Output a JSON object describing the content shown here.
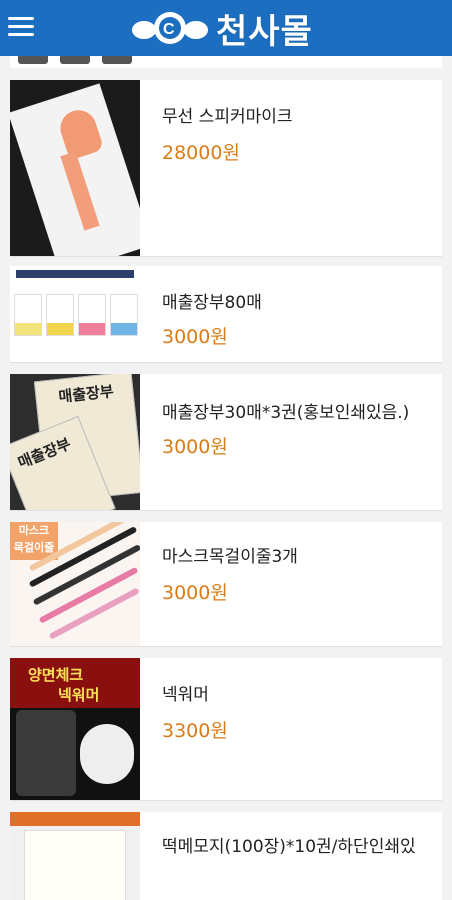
{
  "header": {
    "brand_text": "천사몰",
    "logo_icon": "angel-c-logo-icon",
    "menu_icon": "hamburger-menu-icon",
    "color": "#1c6fc0"
  },
  "products": [
    {
      "name": "무선 스피커마이크",
      "price": "28000원"
    },
    {
      "name": "매출장부80매",
      "price": "3000원"
    },
    {
      "name": "매출장부30매*3권(홍보인쇄있음.)",
      "price": "3000원"
    },
    {
      "name": "마스크목걸이줄3개",
      "price": "3000원"
    },
    {
      "name": "넥워머",
      "price": "3300원"
    },
    {
      "name": "떡메모지(100장)*10권/하단인쇄있",
      "price": ""
    }
  ],
  "thumbs": {
    "ledger_cover_label": "매출장부",
    "mask_tag": "마스크\n목걸이줄",
    "neck_title_1": "양면체크",
    "neck_title_2": "넥워머"
  },
  "price_color": "#d97b18"
}
